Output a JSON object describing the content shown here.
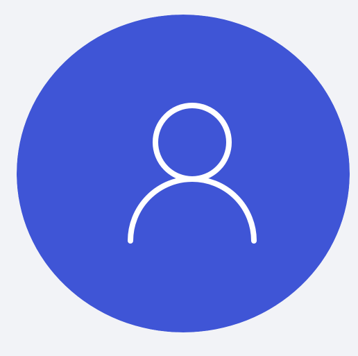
{
  "avatar": {
    "icon": "user-icon",
    "label": "User avatar",
    "colors": {
      "background": "#f2f3f7",
      "circle_fill": "#3f55d6",
      "icon_stroke": "#ffffff"
    }
  }
}
